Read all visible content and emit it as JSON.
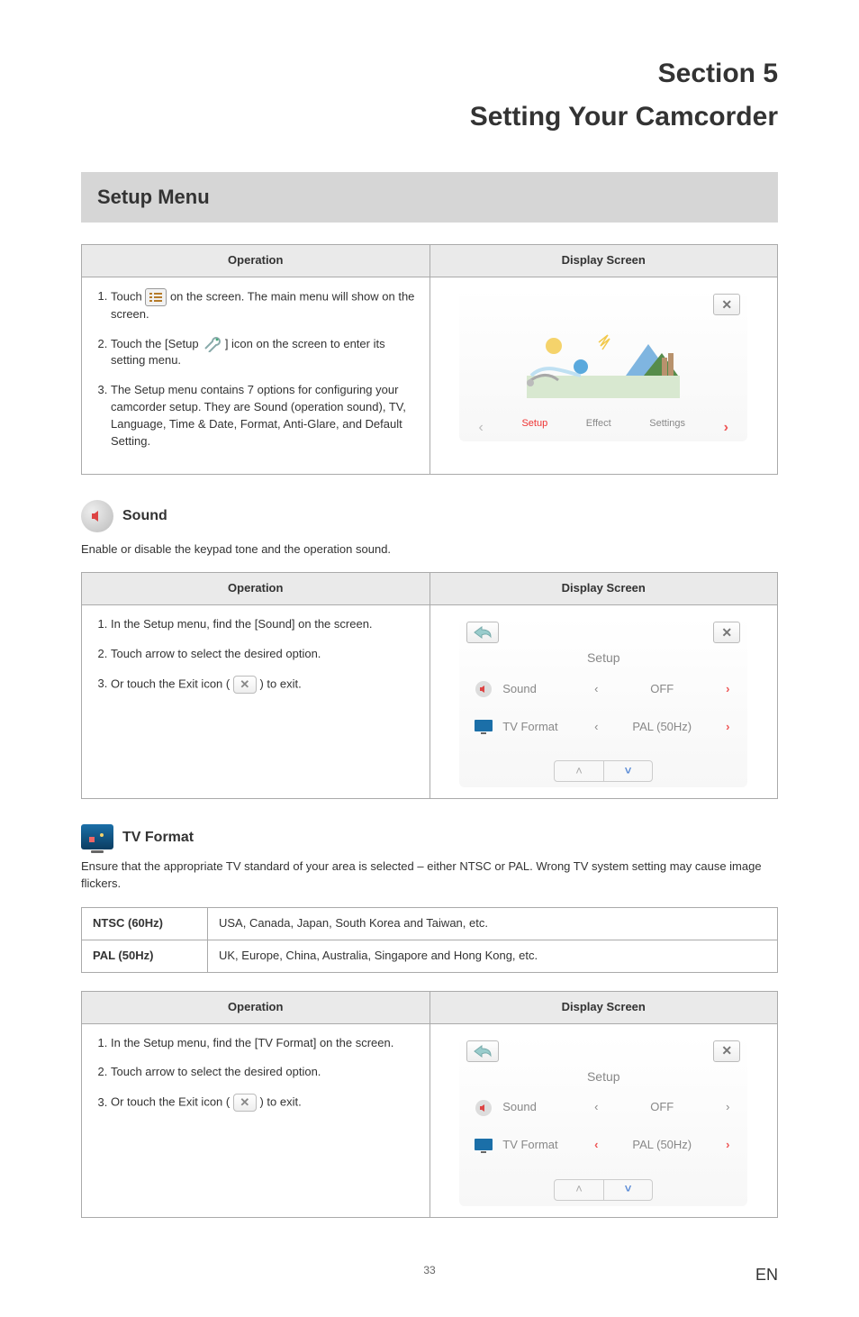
{
  "section_label": "Section 5",
  "page_heading": "Setting Your Camcorder",
  "setup_banner": "Setup Menu",
  "table_headers": {
    "operation": "Operation",
    "display": "Display Screen"
  },
  "setup_steps": {
    "s1a": "Touch ",
    "s1b": " on the screen. The main menu will show on the screen.",
    "s2a": "Touch the [Setup ",
    "s2b": " ] icon on the screen to enter its setting menu.",
    "s3": "The Setup menu contains 7 options for configuring your camcorder setup. They are Sound (operation sound), TV, Language, Time & Date, Format, Anti-Glare, and Default Setting."
  },
  "main_screen_labels": {
    "setup": "Setup",
    "effect": "Effect",
    "settings": "Settings"
  },
  "sound": {
    "title": "Sound",
    "desc": "Enable or disable the keypad tone and the operation sound.",
    "steps": {
      "s1": "In the Setup menu, find the [Sound] on the screen.",
      "s2": "Touch arrow to select the desired option.",
      "s3a": "Or touch the Exit icon ( ",
      "s3b": " ) to exit."
    }
  },
  "tvformat": {
    "title": "TV Format",
    "desc": "Ensure that the appropriate TV standard of your area is selected – either NTSC or PAL. Wrong TV system setting may cause image flickers.",
    "ntsc_label": "NTSC (60Hz)",
    "ntsc_desc": "USA, Canada, Japan, South Korea and Taiwan, etc.",
    "pal_label": "PAL (50Hz)",
    "pal_desc": "UK, Europe, China, Australia, Singapore and Hong Kong, etc.",
    "steps": {
      "s1": "In the Setup menu, find the [TV Format] on the screen.",
      "s2": "Touch arrow to select the desired option.",
      "s3a": "Or touch the Exit icon ( ",
      "s3b": " ) to exit."
    }
  },
  "setup_screen": {
    "title": "Setup",
    "row_sound": "Sound",
    "row_sound_val": "OFF",
    "row_tv": "TV Format",
    "row_tv_val": "PAL (50Hz)"
  },
  "footer": {
    "page": "33",
    "lang": "EN"
  }
}
